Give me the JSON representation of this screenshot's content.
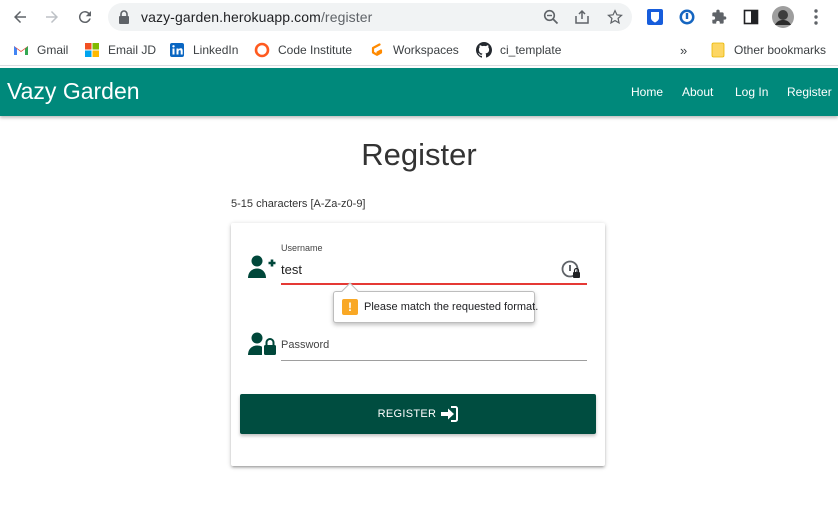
{
  "browser": {
    "url_host": "vazy-garden.herokuapp.com",
    "url_path": "/register"
  },
  "bookmarks": {
    "items": [
      {
        "label": "Gmail",
        "icon": "gmail-icon"
      },
      {
        "label": "Email JD",
        "icon": "microsoft-icon"
      },
      {
        "label": "LinkedIn",
        "icon": "linkedin-icon"
      },
      {
        "label": "Code Institute",
        "icon": "code-institute-icon"
      },
      {
        "label": "Workspaces",
        "icon": "gitpod-icon"
      },
      {
        "label": "ci_template",
        "icon": "github-icon"
      }
    ],
    "overflow": "»",
    "other": "Other bookmarks"
  },
  "site": {
    "brand": "Vazy Garden",
    "nav": [
      "Home",
      "About",
      "Log In",
      "Register"
    ],
    "brand_color": "#00897b"
  },
  "page": {
    "title": "Register",
    "hint": "5-15 characters [A-Za-z0-9]"
  },
  "form": {
    "username_label": "Username",
    "username_value": "test",
    "password_placeholder": "Password",
    "validation_message": "Please match the requested format.",
    "submit_label": "REGISTER",
    "button_color": "#004d40"
  }
}
